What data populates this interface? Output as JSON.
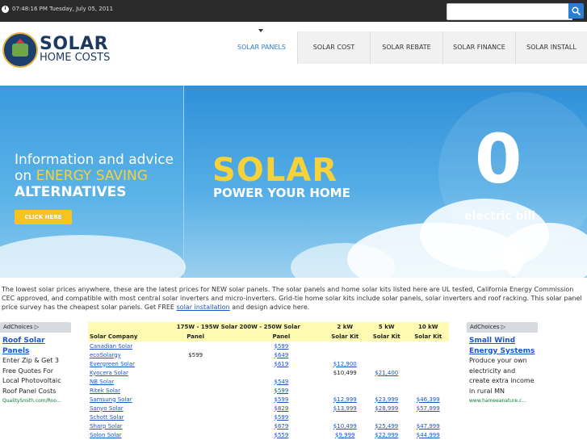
{
  "topbar": {
    "datetime": "07:48:16 PM Tuesday, July 05, 2011",
    "search_placeholder": ""
  },
  "logo": {
    "title": "SOLAR",
    "subtitle": "HOME COSTS"
  },
  "nav": [
    {
      "label": "SOLAR PANELS",
      "active": true
    },
    {
      "label": "SOLAR COST"
    },
    {
      "label": "SOLAR REBATE"
    },
    {
      "label": "SOLAR FINANCE"
    },
    {
      "label": "SOLAR INSTALL"
    }
  ],
  "banner": {
    "line1": "Information and advice",
    "line2_pre": "on ",
    "line2_highlight": "ENERGY SAVING",
    "line3": "ALTERNATIVES",
    "click_here": "CLICK HERE",
    "solar": "SOLAR",
    "power": "POWER YOUR HOME",
    "zero": "0",
    "electric_bill": "electric bill"
  },
  "intro": {
    "text_before": "The lowest solar prices anywhere, these are the latest prices for NEW solar panels. The solar panels and home solar kits listed here are UL tested, California Energy Commission CEC approved, and compatible with most central solar inverters and micro-inverters. Grid-tie home solar kits include solar panels, solar inverters and roof racking. This solar panel price survey has the cheapest solar panels. Get FREE ",
    "link": "solar installation",
    "text_after": " and design advice here."
  },
  "ad_left": {
    "head": "AdChoices ▷",
    "title": "Roof Solar Panels",
    "body": "Enter Zip & Get 3 Free Quotes For Local Photovoltaic Roof Panel Costs",
    "url": "QualitySmith.com/Roo..."
  },
  "ad_right": {
    "head": "AdChoices ▷",
    "title": "Small Wind Energy Systems",
    "body": "Produce your own electricity and create extra income in rural MN",
    "url": "www.hameeanature.c..."
  },
  "table": {
    "group_headers": [
      "175W - 195W Solar",
      "200W - 250W Solar",
      "2 kW",
      "5 kW",
      "10 kW"
    ],
    "sub_headers": [
      "Solar Company",
      "Panel",
      "Panel",
      "Solar Kit",
      "Solar Kit",
      "Solar Kit"
    ],
    "rows": [
      {
        "company": "Canadian Solar",
        "p1": "",
        "p2": "$599",
        "k2": "",
        "k5": "",
        "k10": ""
      },
      {
        "company": "ecoSolargy",
        "p1": "$599",
        "p2": "$649",
        "k2": "",
        "k5": "",
        "k10": ""
      },
      {
        "company": "Evergreen Solar",
        "p1": "",
        "p2": "$619",
        "k2": "$12,900",
        "k5": "",
        "k10": ""
      },
      {
        "company": "Kyocera Solar",
        "p1": "",
        "p2": "",
        "k2": "$10,499",
        "k5": "$21,400",
        "k10": ""
      },
      {
        "company": "NB Solar",
        "p1": "",
        "p2": "$549",
        "k2": "",
        "k5": "",
        "k10": ""
      },
      {
        "company": "Ritek Solar",
        "p1": "",
        "p2": "$599",
        "k2": "",
        "k5": "",
        "k10": ""
      },
      {
        "company": "Samsung Solar",
        "p1": "",
        "p2": "$599",
        "k2": "$12,999",
        "k5": "$23,999",
        "k10": "$46,399"
      },
      {
        "company": "Sanyo Solar",
        "p1": "",
        "p2": "$829",
        "k2": "$13,999",
        "k5": "$28,999",
        "k10": "$57,999"
      },
      {
        "company": "Schott Solar",
        "p1": "",
        "p2": "$599",
        "k2": "",
        "k5": "",
        "k10": ""
      },
      {
        "company": "Sharp Solar",
        "p1": "",
        "p2": "$679",
        "k2": "$10,499",
        "k5": "$25,499",
        "k10": "$47,999"
      },
      {
        "company": "Solon Solar",
        "p1": "",
        "p2": "$559",
        "k2": "$9,999",
        "k5": "$22,999",
        "k10": "$44,999"
      }
    ]
  },
  "colors": {
    "accent": "#2a7fd0",
    "highlight": "#f6d23a",
    "table_header": "#fffab1",
    "link": "#1a55c9"
  }
}
